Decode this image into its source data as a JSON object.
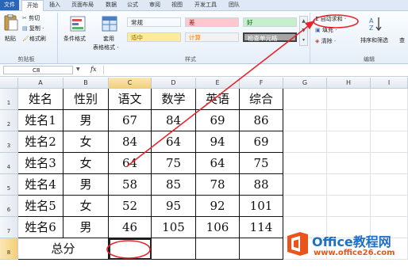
{
  "ribbon_tabs": [
    "文件",
    "开始",
    "插入",
    "页面布局",
    "数据",
    "公式",
    "审阅",
    "视图",
    "开发工具",
    "团队"
  ],
  "clipboard": {
    "paste": "粘贴",
    "cut": "剪切",
    "copy": "复制 ·",
    "format_painter": "格式刷",
    "group_label": "剪贴板"
  },
  "styles": {
    "conditional_format": "条件格式",
    "table_format_1": "套用",
    "table_format_2": "表格格式 ·",
    "cells": [
      {
        "label": "常规",
        "bg": "#ffffff",
        "fg": "#000000"
      },
      {
        "label": "差",
        "bg": "#ffc7ce",
        "fg": "#9c0006"
      },
      {
        "label": "好",
        "bg": "#c6efce",
        "fg": "#006100"
      },
      {
        "label": "适中",
        "bg": "#ffeb9c",
        "fg": "#9c6500"
      },
      {
        "label": "计算",
        "bg": "#f2f2f2",
        "fg": "#fa7d00"
      },
      {
        "label": "检查单元格",
        "bg": "#a5a5a5",
        "fg": "#ffffff"
      }
    ],
    "group_label": "样式"
  },
  "editing": {
    "autosum": "Σ 自动求和 ·",
    "fill": "填充 ·",
    "clear": "清除 ·",
    "sort_filter": "排序和筛选",
    "find": "查",
    "group_label": "编辑"
  },
  "formula_bar": {
    "name_box": "C8",
    "fx": "fx",
    "value": ""
  },
  "grid": {
    "columns": [
      "A",
      "B",
      "C",
      "D",
      "E",
      "F",
      "G",
      "H",
      "I"
    ],
    "selected_column": "C",
    "selected_row": "8",
    "rows": [
      {
        "num": "1",
        "cells": [
          "姓名",
          "性别",
          "语文",
          "数学",
          "英语",
          "综合"
        ]
      },
      {
        "num": "2",
        "cells": [
          "姓名1",
          "男",
          "67",
          "84",
          "69",
          "86"
        ]
      },
      {
        "num": "3",
        "cells": [
          "姓名2",
          "女",
          "84",
          "64",
          "94",
          "69"
        ]
      },
      {
        "num": "4",
        "cells": [
          "姓名3",
          "女",
          "64",
          "75",
          "64",
          "75"
        ]
      },
      {
        "num": "5",
        "cells": [
          "姓名4",
          "男",
          "58",
          "85",
          "78",
          "88"
        ]
      },
      {
        "num": "6",
        "cells": [
          "姓名5",
          "女",
          "52",
          "95",
          "92",
          "101"
        ]
      },
      {
        "num": "7",
        "cells": [
          "姓名6",
          "男",
          "46",
          "105",
          "106",
          "114"
        ]
      },
      {
        "num": "8",
        "cells": [
          "总分",
          "",
          "",
          "",
          "",
          ""
        ]
      }
    ]
  },
  "watermark": {
    "brand": "Office教程网",
    "url": "www.office26.com"
  },
  "annotation_color": "#e8242a",
  "accent": "#2a66b8"
}
